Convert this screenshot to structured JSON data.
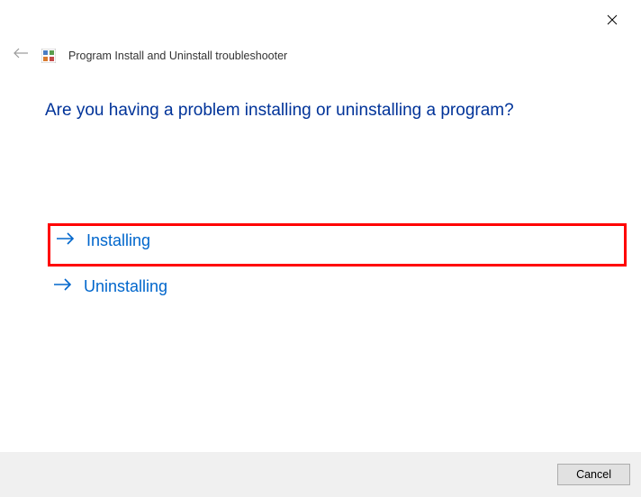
{
  "window": {
    "title": "Program Install and Uninstall troubleshooter"
  },
  "main": {
    "heading": "Are you having a problem installing or uninstalling a program?",
    "options": [
      {
        "label": "Installing"
      },
      {
        "label": "Uninstalling"
      }
    ]
  },
  "footer": {
    "cancel_label": "Cancel"
  }
}
